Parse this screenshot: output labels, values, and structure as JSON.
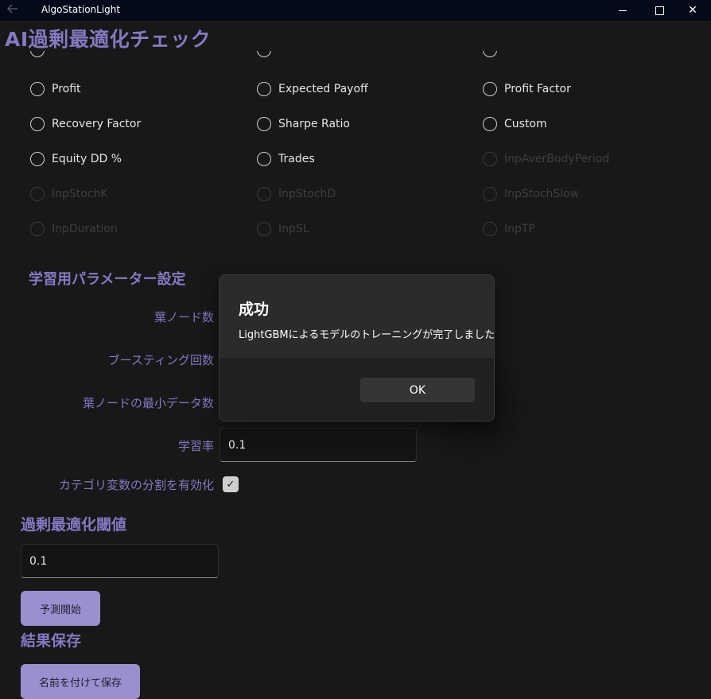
{
  "window": {
    "title": "AlgoStationLight"
  },
  "page": {
    "title": "AI過剰最適化チェック"
  },
  "criteria": [
    {
      "label": "Profit",
      "enabled": true
    },
    {
      "label": "Expected Payoff",
      "enabled": true
    },
    {
      "label": "Profit Factor",
      "enabled": true
    },
    {
      "label": "Recovery Factor",
      "enabled": true
    },
    {
      "label": "Sharpe Ratio",
      "enabled": true
    },
    {
      "label": "Custom",
      "enabled": true
    },
    {
      "label": "Equity DD %",
      "enabled": true
    },
    {
      "label": "Trades",
      "enabled": true
    },
    {
      "label": "InpAverBodyPeriod",
      "enabled": false
    },
    {
      "label": "InpStochK",
      "enabled": false
    },
    {
      "label": "InpStochD",
      "enabled": false
    },
    {
      "label": "InpStochSlow",
      "enabled": false
    },
    {
      "label": "InpDuration",
      "enabled": false
    },
    {
      "label": "InpSL",
      "enabled": false
    },
    {
      "label": "InpTP",
      "enabled": false
    }
  ],
  "training": {
    "title": "学習用パラメーター設定",
    "leaves_label": "葉ノード数",
    "boosting_label": "ブースティング回数",
    "min_data_label": "葉ノードの最小データ数",
    "learning_rate_label": "学習率",
    "learning_rate_value": "0.1",
    "categorical_label": "カテゴリ変数の分割を有効化",
    "categorical_checked": true
  },
  "threshold": {
    "title": "過剰最適化閾値",
    "value": "0.1",
    "predict_button": "予測開始"
  },
  "save": {
    "title": "結果保存",
    "save_as_button": "名前を付けて保存"
  },
  "dialog": {
    "title": "成功",
    "message": "LightGBMによるモデルのトレーニングが完了しました。",
    "ok_button": "OK"
  },
  "colors": {
    "accent": "#8678c2",
    "button": "#9c8fd0",
    "background": "#181818",
    "titlebar": "#050a1a"
  }
}
